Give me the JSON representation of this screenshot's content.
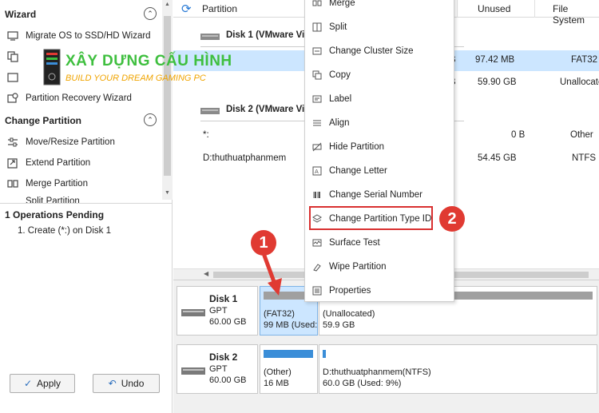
{
  "left_panel": {
    "wizard": {
      "title": "Wizard",
      "items": [
        {
          "label": "Migrate OS to SSD/HD Wizard",
          "icon": "migrate-icon"
        },
        {
          "label": "Copy Partition Wizard",
          "icon": "copy-partition-icon"
        },
        {
          "label": "Copy Disk Wizard",
          "icon": "copy-disk-icon"
        },
        {
          "label": "Partition Recovery Wizard",
          "icon": "recovery-icon"
        }
      ]
    },
    "change_partition": {
      "title": "Change Partition",
      "items": [
        {
          "label": "Move/Resize Partition",
          "icon": "move-resize-icon"
        },
        {
          "label": "Extend Partition",
          "icon": "extend-icon"
        },
        {
          "label": "Merge Partition",
          "icon": "merge-icon"
        },
        {
          "label": "Split Partition",
          "icon": "split-icon"
        }
      ]
    },
    "pending": {
      "title": "1 Operations Pending",
      "items": [
        "1. Create (*:) on Disk 1"
      ]
    },
    "apply_label": "Apply",
    "undo_label": "Undo"
  },
  "watermark": {
    "title": "XÂY DỰNG CẤU HÌNH",
    "subtitle": "BUILD YOUR DREAM GAMING PC"
  },
  "table": {
    "columns": [
      "Partition",
      "Unused",
      "File System"
    ],
    "rows": [
      {
        "type": "disk",
        "label": "Disk 1 (VMware Virt"
      },
      {
        "type": "part",
        "label": "",
        "col3": "B",
        "unused": "97.42 MB",
        "fs": "FAT32",
        "selected": true
      },
      {
        "type": "part",
        "label": "",
        "col3": "B",
        "unused": "59.90 GB",
        "fs": "Unallocate"
      },
      {
        "type": "disk",
        "label": "Disk 2 (VMware Virt"
      },
      {
        "type": "part",
        "label": "*:",
        "col3": "",
        "unused": "0 B",
        "fs": "Other"
      },
      {
        "type": "part",
        "label": "D:thuthuatphanmem",
        "col3": "",
        "unused": "54.45 GB",
        "fs": "NTFS"
      }
    ]
  },
  "disk_map": [
    {
      "name": "Disk 1",
      "type": "GPT",
      "size": "60.00 GB",
      "partitions": [
        {
          "line1": "(FAT32)",
          "line2": "99 MB (Used:",
          "bar_color": "#a0a0a0",
          "selected": true
        },
        {
          "line1": "(Unallocated)",
          "line2": "59.9 GB",
          "bar_color": "#a0a0a0",
          "selected": false
        }
      ]
    },
    {
      "name": "Disk 2",
      "type": "GPT",
      "size": "60.00 GB",
      "partitions": [
        {
          "line1": "(Other)",
          "line2": "16 MB",
          "bar_color": "#3b8ed8",
          "selected": false
        },
        {
          "line1": "D:thuthuatphanmem(NTFS)",
          "line2": "60.0 GB (Used: 9%)",
          "bar_color": "#3b8ed8",
          "selected": false
        }
      ]
    }
  ],
  "context_menu": [
    {
      "label": "Merge",
      "icon": "merge-icon"
    },
    {
      "label": "Split",
      "icon": "split-icon"
    },
    {
      "label": "Change Cluster Size",
      "icon": "cluster-size-icon"
    },
    {
      "label": "Copy",
      "icon": "copy-icon"
    },
    {
      "label": "Label",
      "icon": "label-icon"
    },
    {
      "label": "Align",
      "icon": "align-icon"
    },
    {
      "label": "Hide Partition",
      "icon": "hide-icon"
    },
    {
      "label": "Change Letter",
      "icon": "change-letter-icon"
    },
    {
      "label": "Change Serial Number",
      "icon": "serial-number-icon"
    },
    {
      "label": "Change Partition Type ID",
      "icon": "type-id-icon",
      "highlighted": true
    },
    {
      "label": "Surface Test",
      "icon": "surface-test-icon"
    },
    {
      "label": "Wipe Partition",
      "icon": "wipe-icon"
    },
    {
      "label": "Properties",
      "icon": "properties-icon"
    }
  ],
  "annotations": {
    "badge1": "1",
    "badge2": "2"
  },
  "colors": {
    "accent_red": "#e03a32",
    "selection": "#cce6ff",
    "logo_green": "#3fbf3f",
    "logo_orange": "#f0a400"
  }
}
